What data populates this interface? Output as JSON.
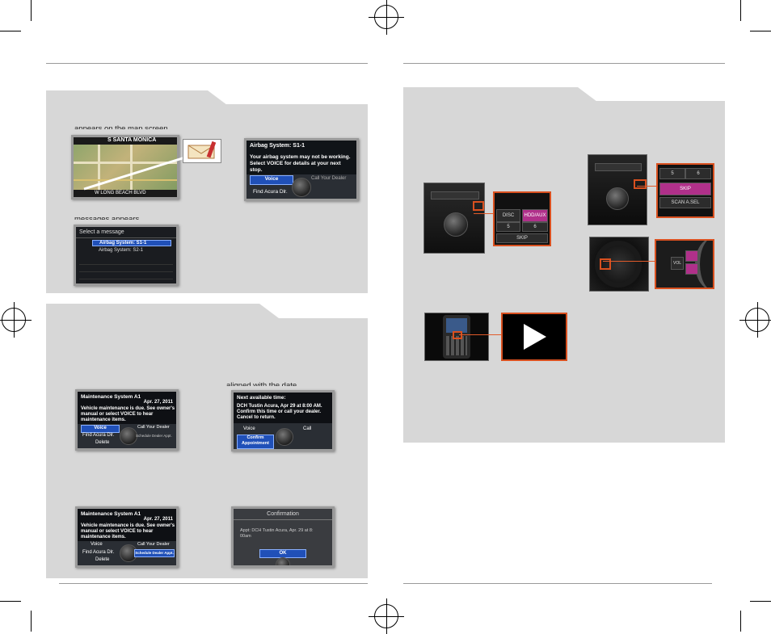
{
  "left_page": {
    "top_cut_text": "appears on the map screen.",
    "mid_cut_text": "messages appears.",
    "right_cut_text": "aligned with the date.",
    "map_screen": {
      "street_top": "S SANTA MONICA",
      "street_bottom": "W LONG BEACH BLVD"
    },
    "airbag_screen": {
      "title": "Airbag System: S1-1",
      "lines": [
        "Your airbag system may not be working.",
        "Select VOICE for details at your next",
        "stop."
      ],
      "voice_label": "Voice",
      "call_label": "Call Your Dealer",
      "find_label": "Find Acura Dlr."
    },
    "message_list": {
      "title": "Select a message",
      "items": [
        "Airbag System: S1-1",
        "Airbag System: S2-1"
      ]
    },
    "maint_screen_1": {
      "title": "Maintenance System A1",
      "date": "Apr. 27, 2011",
      "lines": [
        "Vehicle maintenance is due. See owner's",
        "manual or select VOICE to hear",
        "maintenance items."
      ],
      "voice_label": "Voice",
      "call_label": "Call Your Dealer",
      "find_label": "Find Acura Dlr.",
      "schedule_label": "Schedule Dealer Appt.",
      "delete_label": "Delete"
    },
    "next_time_screen": {
      "title": "Next available time:",
      "lines": [
        "DCH Tustin Acura, Apr 29 at 8:00 AM.",
        "Confirm this time or call your dealer.",
        "Cancel to return."
      ],
      "voice_label": "Voice",
      "call_label": "Call",
      "confirm_label_1": "Confirm",
      "confirm_label_2": "Appointment"
    },
    "maint_screen_2": {
      "title": "Maintenance System A1",
      "date": "Apr. 27, 2011",
      "lines": [
        "Vehicle maintenance is due. See owner's",
        "manual or select VOICE to hear",
        "maintenance items."
      ],
      "voice_label": "Voice",
      "call_label": "Call Your Dealer",
      "find_label": "Find Acura Dlr.",
      "schedule_label": "Schedule Dealer Appt.",
      "delete_label": "Delete"
    },
    "confirmation_screen": {
      "title": "Confirmation",
      "line_1": "Appt: DCH Tustin Acura, Apr. 29 at 8:",
      "line_2": "00am",
      "ok_label": "OK"
    }
  },
  "right_page": {
    "console_zoom_keys": [
      "DISC",
      "HDD/AUX",
      "5",
      "6",
      "SKIP"
    ],
    "audio_zoom_keys": [
      "5",
      "6",
      "SKIP",
      "SCAN A.SEL"
    ],
    "wheel_zoom_keys": [
      "VOL",
      "",
      ""
    ],
    "play_icon": "play-icon"
  },
  "colors": {
    "panel_gray": "#d7d7d7",
    "accent_orange": "#d9501f",
    "highlight_blue": "#2050b8",
    "button_pink": "#b0308a"
  }
}
